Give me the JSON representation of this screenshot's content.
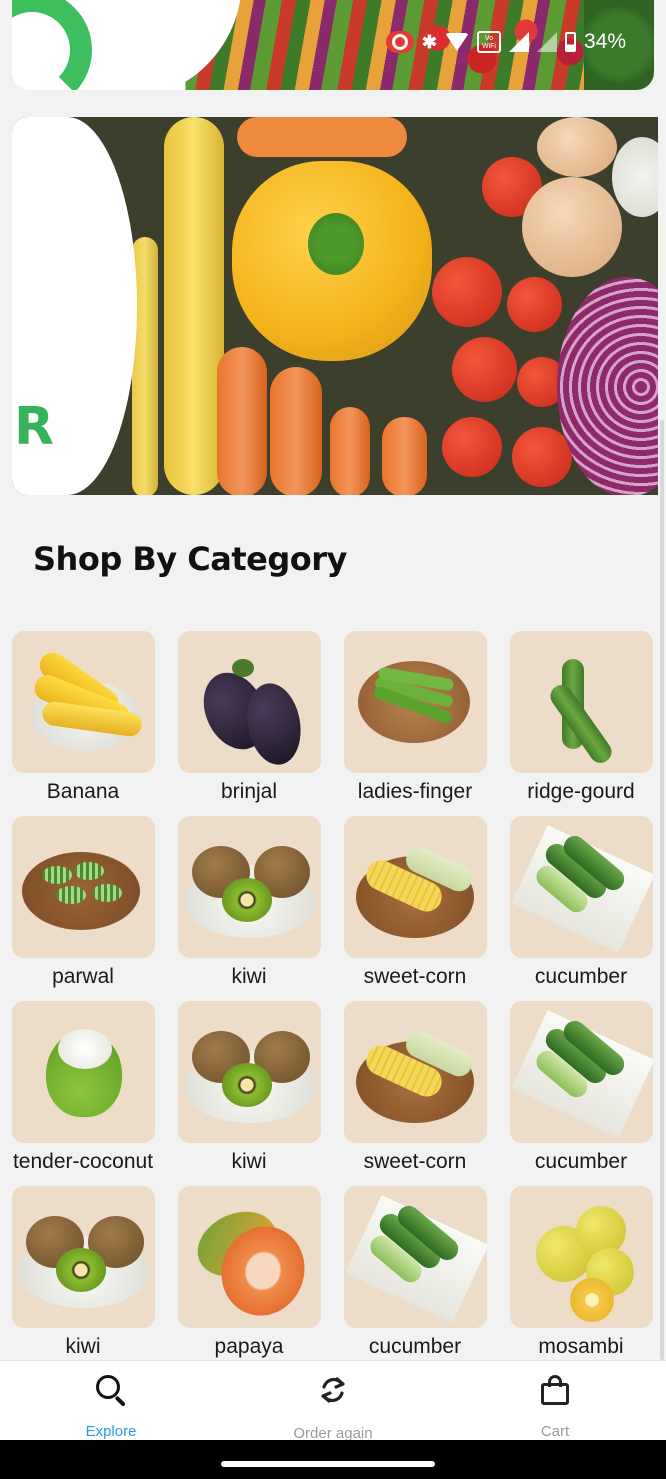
{
  "status_bar": {
    "battery_percent": "34%",
    "vowifi_label": "Vo WiFi",
    "icons": [
      "screen-record-icon",
      "bluetooth-icon",
      "wifi-icon",
      "vowifi-icon",
      "signal-icon",
      "signal-icon",
      "battery-icon"
    ]
  },
  "hero": {
    "brand_letter": "R"
  },
  "section": {
    "title": "Shop By Category"
  },
  "categories": [
    {
      "label": "Banana",
      "image": "banana"
    },
    {
      "label": "brinjal",
      "image": "brinjal"
    },
    {
      "label": "ladies-finger",
      "image": "ladies-finger"
    },
    {
      "label": "ridge-gourd",
      "image": "ridge-gourd"
    },
    {
      "label": "parwal",
      "image": "parwal"
    },
    {
      "label": "kiwi",
      "image": "kiwi"
    },
    {
      "label": "sweet-corn",
      "image": "sweet-corn"
    },
    {
      "label": "cucumber",
      "image": "cucumber"
    },
    {
      "label": "tender-coconut",
      "image": "tender-coconut"
    },
    {
      "label": "kiwi",
      "image": "kiwi"
    },
    {
      "label": "sweet-corn",
      "image": "sweet-corn"
    },
    {
      "label": "cucumber",
      "image": "cucumber"
    },
    {
      "label": "kiwi",
      "image": "kiwi"
    },
    {
      "label": "papaya",
      "image": "papaya"
    },
    {
      "label": "cucumber",
      "image": "cucumber"
    },
    {
      "label": "mosambi",
      "image": "mosambi"
    }
  ],
  "bottom_nav": {
    "items": [
      {
        "label": "Explore",
        "icon": "search-icon",
        "active": true
      },
      {
        "label": "Order again",
        "icon": "refresh-icon",
        "active": false
      },
      {
        "label": "Cart",
        "icon": "shopping-bag-icon",
        "active": false
      }
    ]
  },
  "colors": {
    "accent": "#2e9ae6",
    "brand_green": "#36b25a",
    "inactive": "#9a9a9a"
  }
}
